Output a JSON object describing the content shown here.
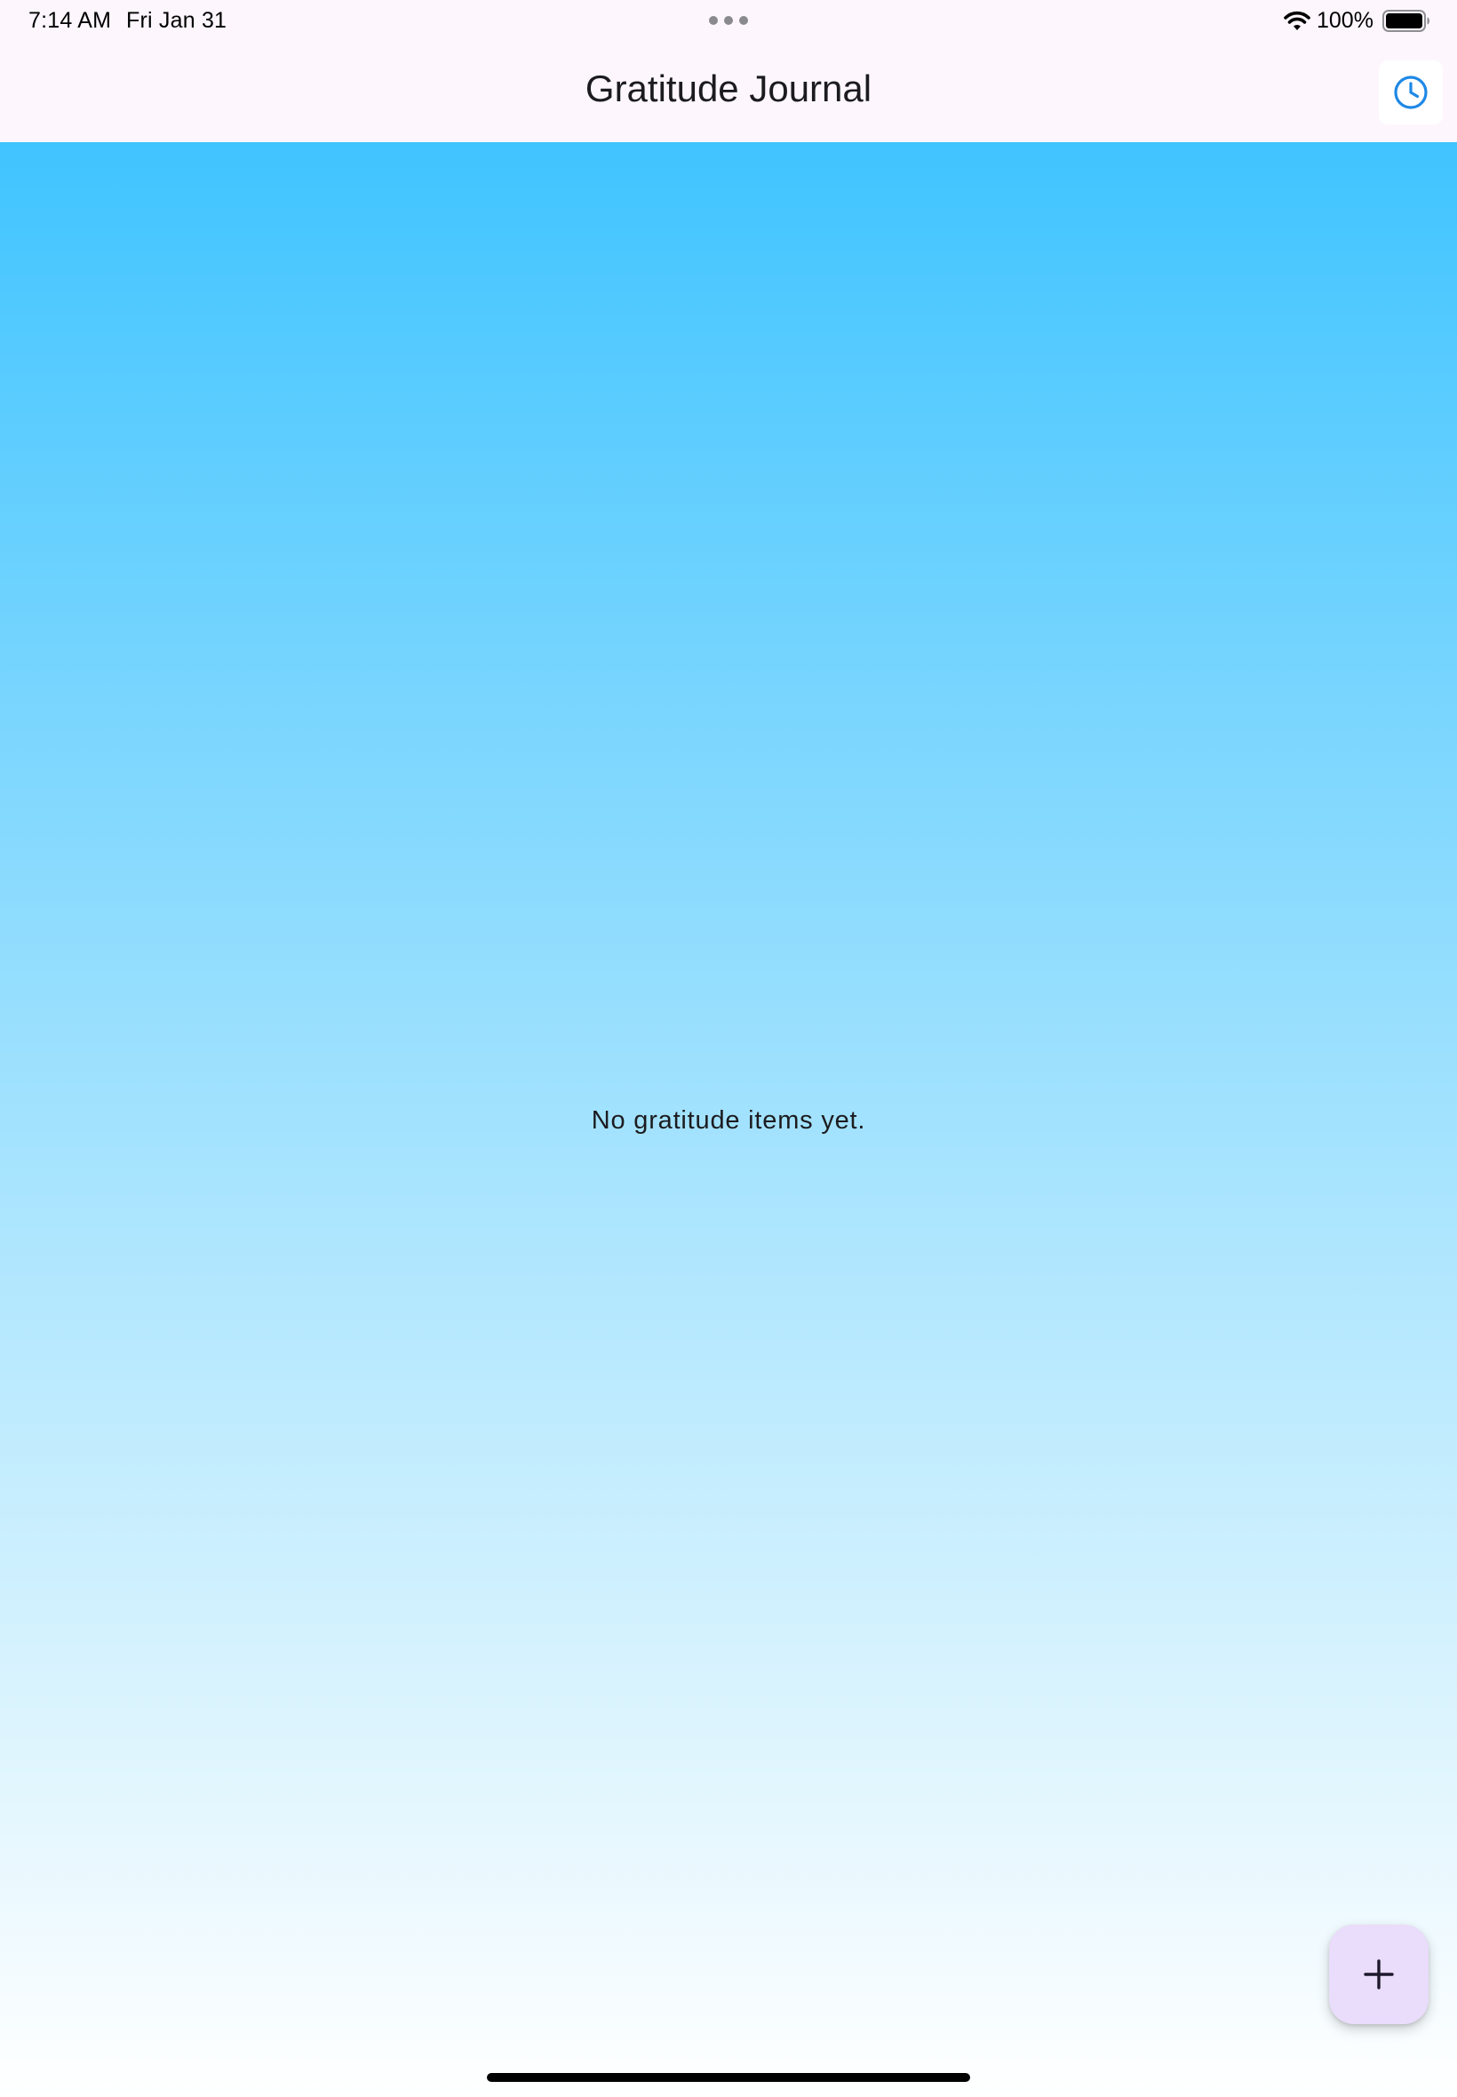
{
  "status_bar": {
    "time": "7:14 AM",
    "date": "Fri Jan 31",
    "battery_percent": "100%",
    "battery_level": 1.0,
    "icons": [
      "multitask-dots",
      "wifi-icon",
      "battery-icon"
    ]
  },
  "app_bar": {
    "title": "Gratitude Journal",
    "action_icon": "clock-icon",
    "action_icon_color": "#1e88e5"
  },
  "main": {
    "empty_message": "No gratitude items yet.",
    "background_gradient": [
      "#40c4ff",
      "#ffffff"
    ]
  },
  "fab": {
    "icon": "plus-icon",
    "background": "#eadcfb"
  }
}
